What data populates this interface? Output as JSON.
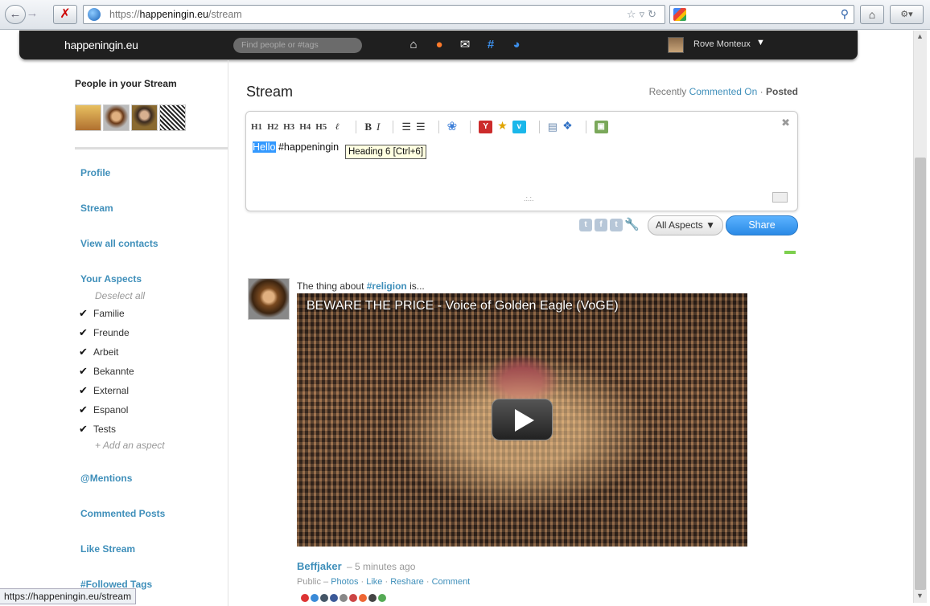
{
  "browser": {
    "url_prefix": "https://",
    "url_domain": "happeningin.eu",
    "url_path": "/stream",
    "status_text": "https://happeningin.eu/stream"
  },
  "header": {
    "logo": "happeningin.eu",
    "search_placeholder": "Find people or #tags",
    "user_name": "Rove Monteux",
    "icons": [
      "home-icon",
      "notifications-icon",
      "messages-icon",
      "tags-icon",
      "aspects-icon"
    ]
  },
  "sidebar": {
    "people_title": "People in your Stream",
    "profile": "Profile",
    "stream": "Stream",
    "view_contacts": "View all contacts",
    "your_aspects": "Your Aspects",
    "deselect_all": "Deselect all",
    "aspects": [
      "Familie",
      "Freunde",
      "Arbeit",
      "Bekannte",
      "External",
      "Espanol",
      "Tests"
    ],
    "add_aspect": "+ Add an aspect",
    "mentions": "@Mentions",
    "commented_posts": "Commented Posts",
    "like_stream": "Like Stream",
    "followed_tags": "#Followed Tags"
  },
  "main": {
    "title": "Stream",
    "sort_prefix": "Recently",
    "sort_commented": "Commented On",
    "sort_sep": "·",
    "sort_posted": "Posted"
  },
  "publisher": {
    "toolbar": [
      "H1",
      "H2",
      "H3",
      "H4",
      "H5"
    ],
    "text_selected": "Hello",
    "text_rest": " #happeningin",
    "tooltip": "Heading 6 [Ctrl+6]",
    "aspect_select": "All Aspects ▼",
    "share_label": "Share"
  },
  "post": {
    "text_prefix": "The thing about ",
    "tag": "#religion",
    "text_suffix": " is...",
    "video_title": "BEWARE THE PRICE - Voice of Golden Eagle (VoGE)",
    "author": "Beffjaker",
    "time": "– 5 minutes ago",
    "visibility": "Public –",
    "photos": "Photos",
    "like": "Like",
    "reshare": "Reshare",
    "comment": "Comment"
  },
  "colors": {
    "link": "#3f8fba",
    "header_bg": "#1f1f1f",
    "share_button": "#2a8ae6"
  }
}
